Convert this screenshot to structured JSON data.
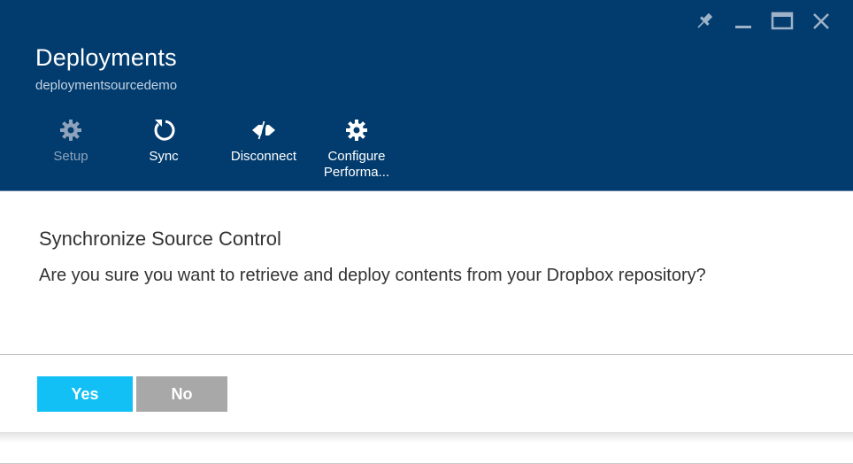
{
  "header": {
    "title": "Deployments",
    "subtitle": "deploymentsourcedemo",
    "background_color": "#023c6e",
    "commands": [
      {
        "label": "Setup",
        "icon": "gear-icon",
        "enabled": false
      },
      {
        "label": "Sync",
        "icon": "refresh-icon",
        "enabled": true
      },
      {
        "label": "Disconnect",
        "icon": "disconnect-icon",
        "enabled": true
      },
      {
        "label": "Configure Performa...",
        "label_line1": "Configure",
        "label_line2": "Performa...",
        "icon": "gear-icon",
        "enabled": true
      }
    ],
    "window_controls": [
      "pin-icon",
      "minimize-icon",
      "maximize-icon",
      "close-icon"
    ]
  },
  "dialog": {
    "title": "Synchronize Source Control",
    "message": "Are you sure you want to retrieve and deploy contents from your Dropbox repository?",
    "yes_label": "Yes",
    "no_label": "No",
    "yes_color": "#12c0f5",
    "no_color": "#a8a8a8"
  }
}
